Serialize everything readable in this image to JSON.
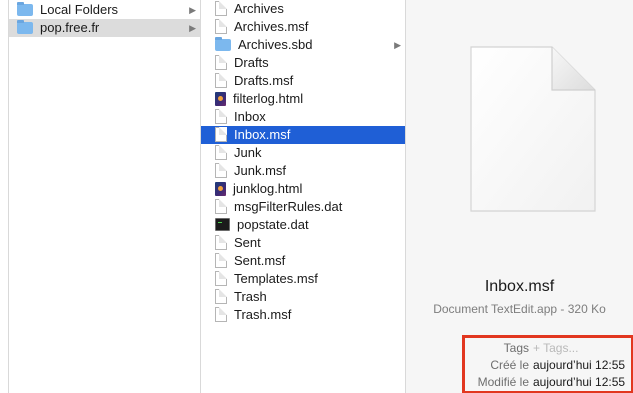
{
  "sidebar": {
    "items": [
      {
        "label": "Local Folders",
        "icon": "folder-icon",
        "selected": false
      },
      {
        "label": "pop.free.fr",
        "icon": "folder-icon",
        "selected": true
      }
    ]
  },
  "file_list": {
    "items": [
      {
        "name": "Archives",
        "icon": "document-icon"
      },
      {
        "name": "Archives.msf",
        "icon": "document-icon"
      },
      {
        "name": "Archives.sbd",
        "icon": "folder-icon",
        "has_children": true
      },
      {
        "name": "Drafts",
        "icon": "document-icon"
      },
      {
        "name": "Drafts.msf",
        "icon": "document-icon"
      },
      {
        "name": "filterlog.html",
        "icon": "html-file-icon"
      },
      {
        "name": "Inbox",
        "icon": "document-icon"
      },
      {
        "name": "Inbox.msf",
        "icon": "document-icon",
        "selected": true
      },
      {
        "name": "Junk",
        "icon": "document-icon"
      },
      {
        "name": "Junk.msf",
        "icon": "document-icon"
      },
      {
        "name": "junklog.html",
        "icon": "html-file-icon"
      },
      {
        "name": "msgFilterRules.dat",
        "icon": "document-icon"
      },
      {
        "name": "popstate.dat",
        "icon": "terminal-file-icon"
      },
      {
        "name": "Sent",
        "icon": "document-icon"
      },
      {
        "name": "Sent.msf",
        "icon": "document-icon"
      },
      {
        "name": "Templates.msf",
        "icon": "document-icon"
      },
      {
        "name": "Trash",
        "icon": "document-icon"
      },
      {
        "name": "Trash.msf",
        "icon": "document-icon"
      }
    ]
  },
  "preview": {
    "title": "Inbox.msf",
    "subtitle": "Document TextEdit.app - 320 Ko",
    "tags_label": "Tags",
    "tags_placeholder": "+ Tags...",
    "created_label": "Créé le",
    "created_value": "aujourd’hui 12:55",
    "modified_label": "Modifié le",
    "modified_value": "aujourd’hui 12:55"
  },
  "colors": {
    "selection_active": "#1f5fd6",
    "selection_inactive": "#dcdcdc",
    "highlight_box": "#e2371f",
    "folder": "#7cb8ee"
  }
}
